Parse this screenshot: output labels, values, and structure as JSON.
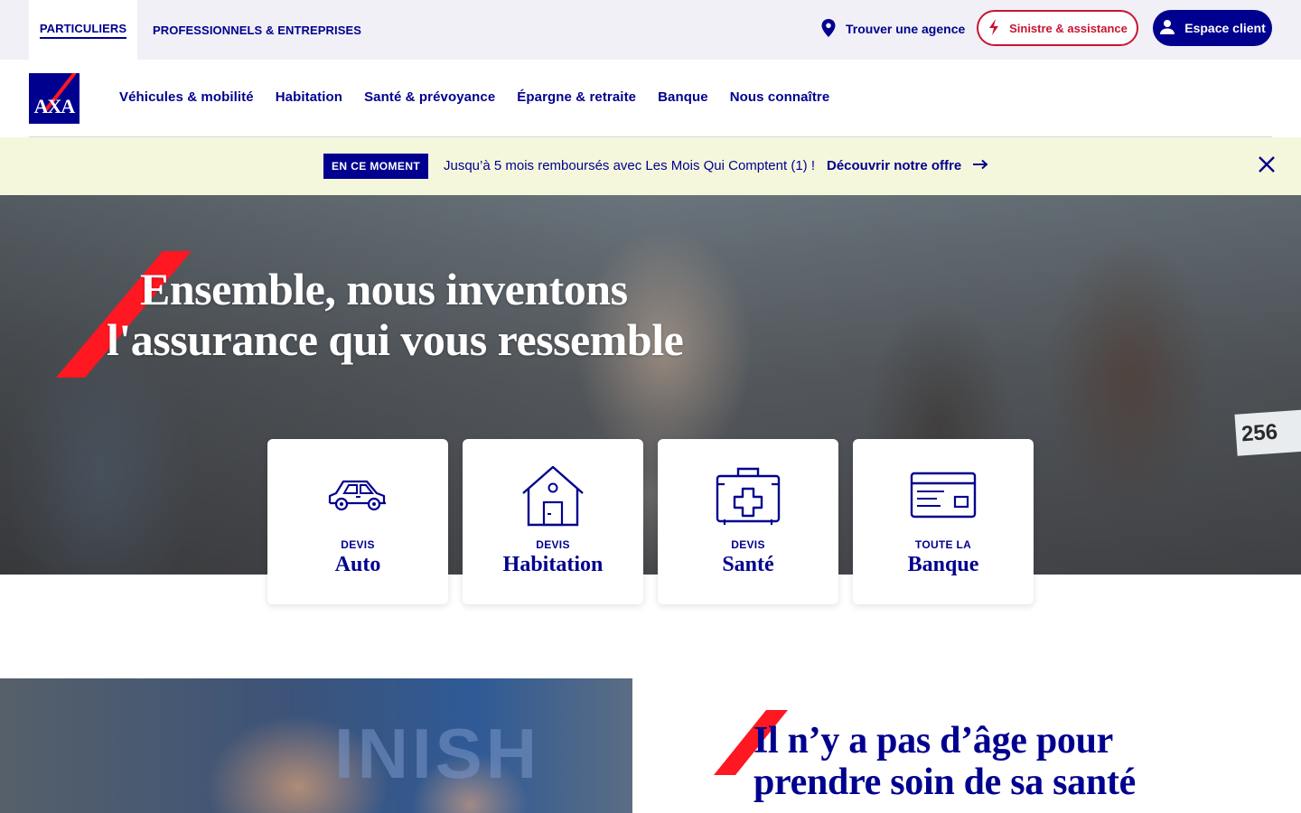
{
  "top_bar": {
    "segments": [
      "PARTICULIERS",
      "PROFESSIONNELS & ENTREPRISES"
    ],
    "agency_label": "Trouver une agence",
    "sinistre_label": "Sinistre & assistance",
    "client_label": "Espace client"
  },
  "logo": {
    "text": "AXA"
  },
  "nav": {
    "items": [
      "Véhicules & mobilité",
      "Habitation",
      "Santé & prévoyance",
      "Épargne & retraite",
      "Banque",
      "Nous connaître"
    ]
  },
  "promo": {
    "badge": "EN CE MOMENT",
    "text": "Jusqu’à 5 mois remboursés avec Les Mois Qui Comptent (1) !",
    "link": "Découvrir notre offre"
  },
  "hero": {
    "title_line1": "Ensemble, nous inventons",
    "title_line2": "l'assurance qui vous ressemble",
    "bib_number": "256"
  },
  "cards": [
    {
      "kicker": "DEVIS",
      "title": "Auto",
      "icon": "car-icon"
    },
    {
      "kicker": "DEVIS",
      "title": "Habitation",
      "icon": "house-icon"
    },
    {
      "kicker": "DEVIS",
      "title": "Santé",
      "icon": "first-aid-kit-icon"
    },
    {
      "kicker": "TOUTE LA",
      "title": "Banque",
      "icon": "bank-card-icon"
    }
  ],
  "section": {
    "title_line1": "Il n’y a pas d’âge pour",
    "title_line2": "prendre soin de sa santé",
    "photo_text": "INISH"
  },
  "colors": {
    "brand_blue": "#00008f",
    "brand_red": "#ff1721",
    "alert_red": "#c91432",
    "promo_bg": "#f5f7dc"
  }
}
